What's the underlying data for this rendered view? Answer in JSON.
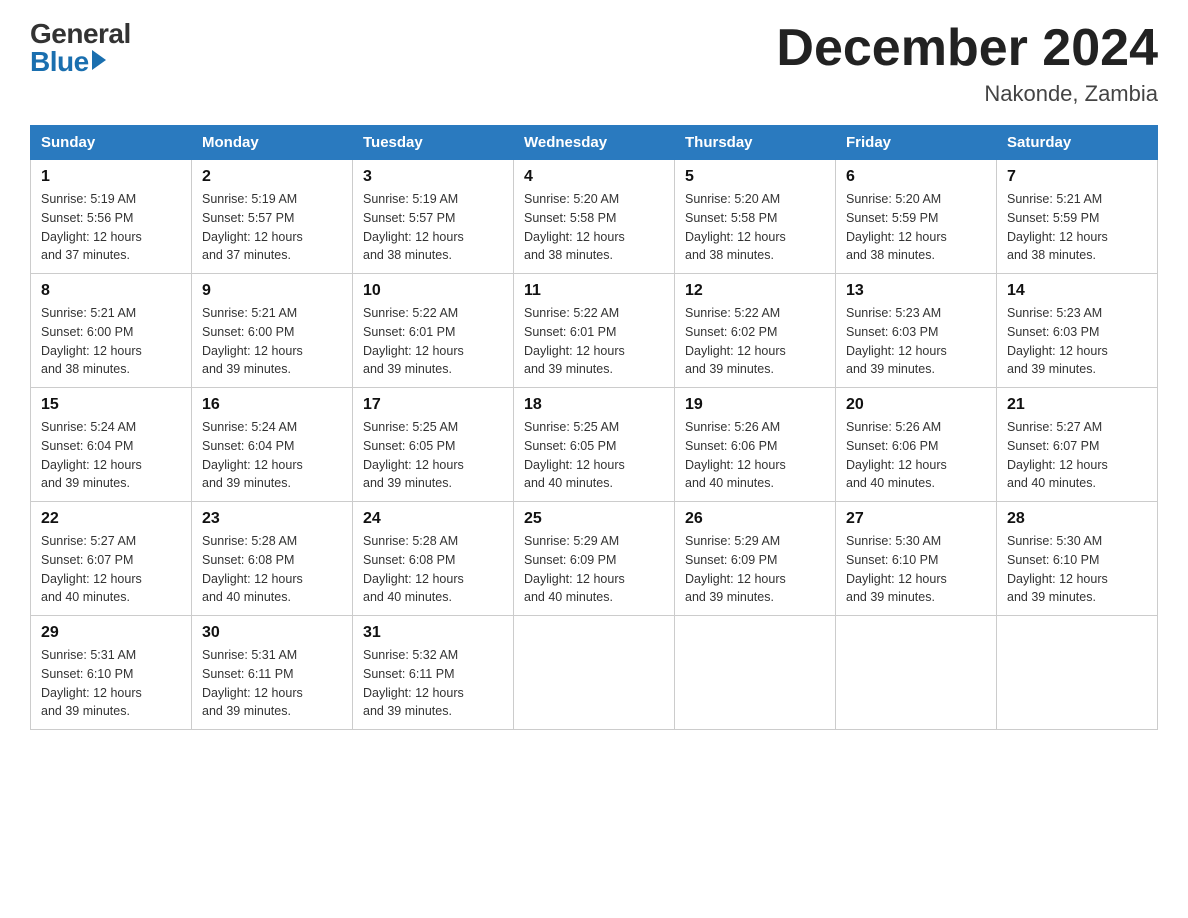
{
  "header": {
    "title": "December 2024",
    "location": "Nakonde, Zambia",
    "logo_top": "General",
    "logo_bottom": "Blue"
  },
  "weekdays": [
    "Sunday",
    "Monday",
    "Tuesday",
    "Wednesday",
    "Thursday",
    "Friday",
    "Saturday"
  ],
  "weeks": [
    [
      {
        "day": "1",
        "sunrise": "5:19 AM",
        "sunset": "5:56 PM",
        "daylight": "12 hours and 37 minutes."
      },
      {
        "day": "2",
        "sunrise": "5:19 AM",
        "sunset": "5:57 PM",
        "daylight": "12 hours and 37 minutes."
      },
      {
        "day": "3",
        "sunrise": "5:19 AM",
        "sunset": "5:57 PM",
        "daylight": "12 hours and 38 minutes."
      },
      {
        "day": "4",
        "sunrise": "5:20 AM",
        "sunset": "5:58 PM",
        "daylight": "12 hours and 38 minutes."
      },
      {
        "day": "5",
        "sunrise": "5:20 AM",
        "sunset": "5:58 PM",
        "daylight": "12 hours and 38 minutes."
      },
      {
        "day": "6",
        "sunrise": "5:20 AM",
        "sunset": "5:59 PM",
        "daylight": "12 hours and 38 minutes."
      },
      {
        "day": "7",
        "sunrise": "5:21 AM",
        "sunset": "5:59 PM",
        "daylight": "12 hours and 38 minutes."
      }
    ],
    [
      {
        "day": "8",
        "sunrise": "5:21 AM",
        "sunset": "6:00 PM",
        "daylight": "12 hours and 38 minutes."
      },
      {
        "day": "9",
        "sunrise": "5:21 AM",
        "sunset": "6:00 PM",
        "daylight": "12 hours and 39 minutes."
      },
      {
        "day": "10",
        "sunrise": "5:22 AM",
        "sunset": "6:01 PM",
        "daylight": "12 hours and 39 minutes."
      },
      {
        "day": "11",
        "sunrise": "5:22 AM",
        "sunset": "6:01 PM",
        "daylight": "12 hours and 39 minutes."
      },
      {
        "day": "12",
        "sunrise": "5:22 AM",
        "sunset": "6:02 PM",
        "daylight": "12 hours and 39 minutes."
      },
      {
        "day": "13",
        "sunrise": "5:23 AM",
        "sunset": "6:03 PM",
        "daylight": "12 hours and 39 minutes."
      },
      {
        "day": "14",
        "sunrise": "5:23 AM",
        "sunset": "6:03 PM",
        "daylight": "12 hours and 39 minutes."
      }
    ],
    [
      {
        "day": "15",
        "sunrise": "5:24 AM",
        "sunset": "6:04 PM",
        "daylight": "12 hours and 39 minutes."
      },
      {
        "day": "16",
        "sunrise": "5:24 AM",
        "sunset": "6:04 PM",
        "daylight": "12 hours and 39 minutes."
      },
      {
        "day": "17",
        "sunrise": "5:25 AM",
        "sunset": "6:05 PM",
        "daylight": "12 hours and 39 minutes."
      },
      {
        "day": "18",
        "sunrise": "5:25 AM",
        "sunset": "6:05 PM",
        "daylight": "12 hours and 40 minutes."
      },
      {
        "day": "19",
        "sunrise": "5:26 AM",
        "sunset": "6:06 PM",
        "daylight": "12 hours and 40 minutes."
      },
      {
        "day": "20",
        "sunrise": "5:26 AM",
        "sunset": "6:06 PM",
        "daylight": "12 hours and 40 minutes."
      },
      {
        "day": "21",
        "sunrise": "5:27 AM",
        "sunset": "6:07 PM",
        "daylight": "12 hours and 40 minutes."
      }
    ],
    [
      {
        "day": "22",
        "sunrise": "5:27 AM",
        "sunset": "6:07 PM",
        "daylight": "12 hours and 40 minutes."
      },
      {
        "day": "23",
        "sunrise": "5:28 AM",
        "sunset": "6:08 PM",
        "daylight": "12 hours and 40 minutes."
      },
      {
        "day": "24",
        "sunrise": "5:28 AM",
        "sunset": "6:08 PM",
        "daylight": "12 hours and 40 minutes."
      },
      {
        "day": "25",
        "sunrise": "5:29 AM",
        "sunset": "6:09 PM",
        "daylight": "12 hours and 40 minutes."
      },
      {
        "day": "26",
        "sunrise": "5:29 AM",
        "sunset": "6:09 PM",
        "daylight": "12 hours and 39 minutes."
      },
      {
        "day": "27",
        "sunrise": "5:30 AM",
        "sunset": "6:10 PM",
        "daylight": "12 hours and 39 minutes."
      },
      {
        "day": "28",
        "sunrise": "5:30 AM",
        "sunset": "6:10 PM",
        "daylight": "12 hours and 39 minutes."
      }
    ],
    [
      {
        "day": "29",
        "sunrise": "5:31 AM",
        "sunset": "6:10 PM",
        "daylight": "12 hours and 39 minutes."
      },
      {
        "day": "30",
        "sunrise": "5:31 AM",
        "sunset": "6:11 PM",
        "daylight": "12 hours and 39 minutes."
      },
      {
        "day": "31",
        "sunrise": "5:32 AM",
        "sunset": "6:11 PM",
        "daylight": "12 hours and 39 minutes."
      },
      null,
      null,
      null,
      null
    ]
  ],
  "labels": {
    "sunrise": "Sunrise:",
    "sunset": "Sunset:",
    "daylight": "Daylight:"
  }
}
